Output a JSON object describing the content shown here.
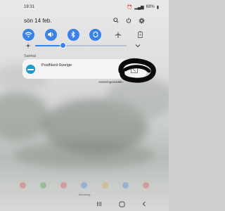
{
  "status_bar": {
    "time": "19:31",
    "battery": "69%"
  },
  "header": {
    "date": "sön 14 feb."
  },
  "quick_settings": [
    {
      "name": "wifi",
      "icon": "wifi-icon",
      "active": true
    },
    {
      "name": "sound",
      "icon": "speaker-icon",
      "active": true
    },
    {
      "name": "bluetooth",
      "icon": "bluetooth-icon",
      "active": true
    },
    {
      "name": "auto-rotate",
      "icon": "rotate-icon",
      "active": true
    },
    {
      "name": "airplane-mode",
      "icon": "airplane-icon",
      "active": false
    },
    {
      "name": "power-saving",
      "icon": "battery-icon",
      "active": false
    }
  ],
  "brightness": {
    "level": 0.3
  },
  "notifications": {
    "section_label": "Samtal",
    "items": [
      {
        "app_name": "PostNord Sverige",
        "icon": "postnord-icon"
      }
    ],
    "settings_label": "Aviseringsinställn."
  },
  "carrier": "Samsung",
  "colors": {
    "accent": "#3b82e8",
    "card": "#f4f4f4",
    "app_icon": "#1f9ac9"
  }
}
